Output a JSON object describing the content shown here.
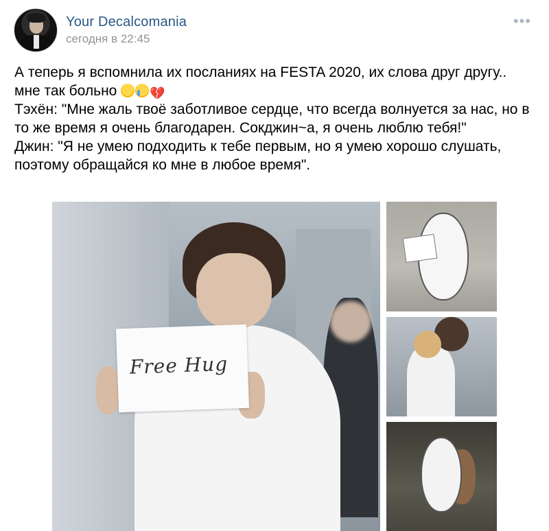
{
  "post": {
    "author": "Your Decalcomania",
    "timestamp": "сегодня в 22:45",
    "more_label": "•••",
    "text": "А теперь я вспомнила их посланиях на FESTA 2020, их слова друг другу.. мне так больно",
    "text_line2": "Тэхён: \"Мне жаль твоё заботливое сердце, что всегда волнуется за нас, но в то же время я очень благодарен. Сокджин~а, я очень люблю тебя!\"",
    "text_line3": "Джин: \"Я не умею подходить к тебе первым, но я умею хорошо слушать, поэтому обращайся ко мне в любое время\".",
    "emojis": [
      "anxious-face-icon",
      "crying-face-icon",
      "broken-heart-icon"
    ]
  },
  "gallery": {
    "main_photo_sign": "Free Hug",
    "thumbnails": [
      "bear-holding-sign-photo",
      "hug-photo",
      "bears-hug-photo"
    ]
  },
  "colors": {
    "author": "#2a5885",
    "timestamp": "#939393",
    "more": "#aeb7c2"
  }
}
